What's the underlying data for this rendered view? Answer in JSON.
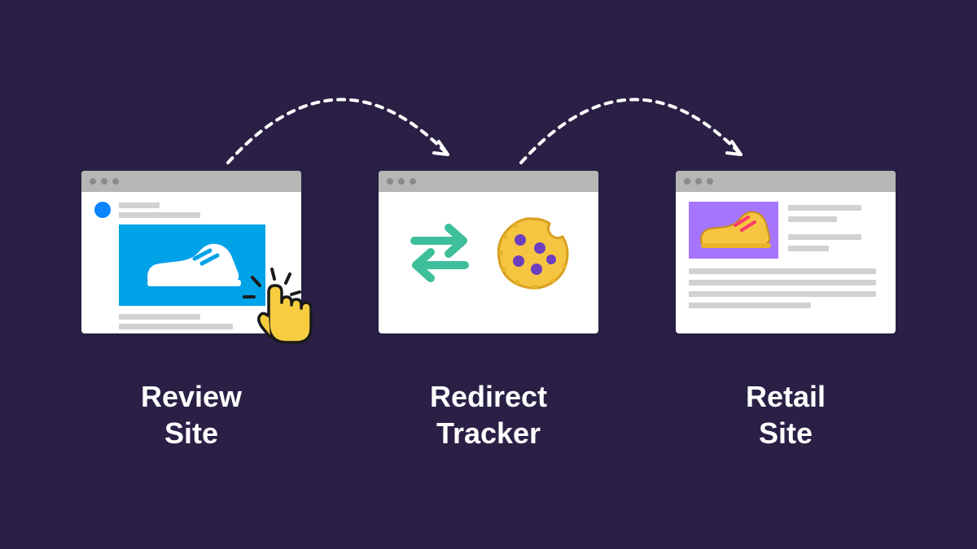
{
  "panels": [
    {
      "id": "review",
      "label_line1": "Review",
      "label_line2": "Site"
    },
    {
      "id": "redirect",
      "label_line1": "Redirect",
      "label_line2": "Tracker"
    },
    {
      "id": "retail",
      "label_line1": "Retail",
      "label_line2": "Site"
    }
  ],
  "colors": {
    "background": "#2a2046",
    "titlebar": "#b6b6b6",
    "accent_blue": "#00a2e8",
    "accent_purple": "#a575ff",
    "cookie": "#f5c542",
    "arrow_green": "#3ebf9b",
    "cursor_yellow": "#f7cc3f",
    "text_white": "#ffffff"
  },
  "icons": {
    "left_panel": "shoe-blue",
    "middle_panel": [
      "two-way-arrows",
      "cookie"
    ],
    "right_panel": "shoe-yellow",
    "overlay": "cursor-click"
  }
}
